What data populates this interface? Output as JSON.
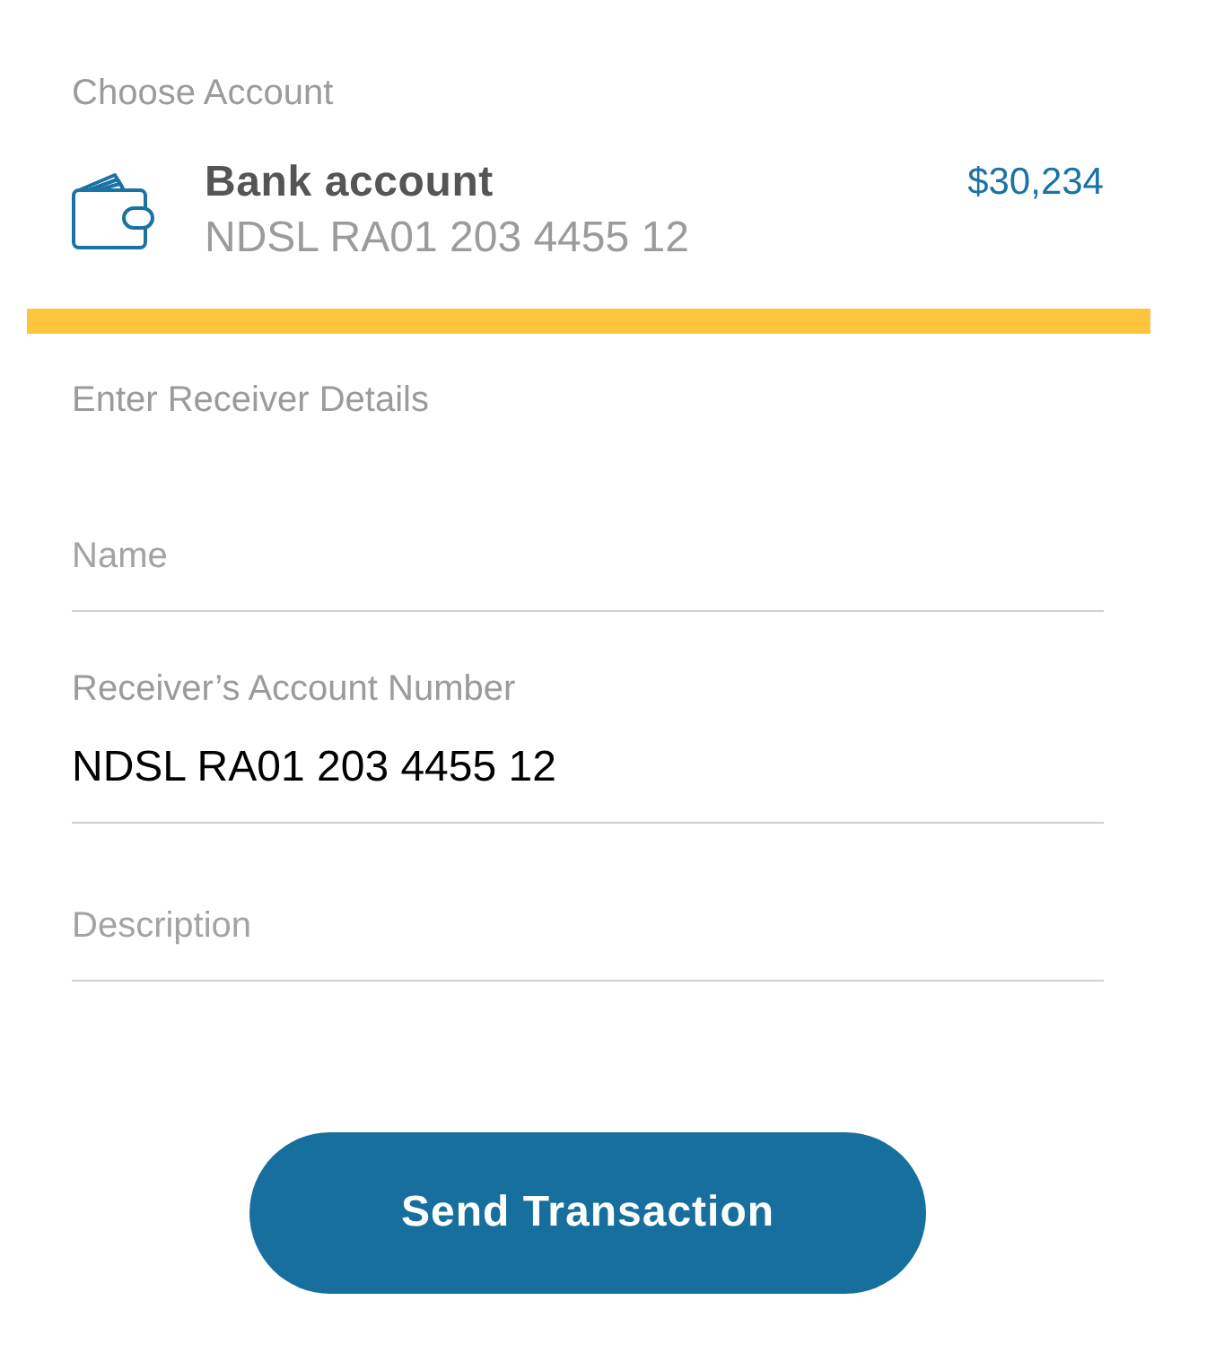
{
  "account_section": {
    "heading": "Choose Account",
    "account": {
      "name": "Bank account",
      "number": "NDSL RA01 203 4455 12",
      "balance": "$30,234"
    }
  },
  "receiver_section": {
    "heading": "Enter Receiver Details",
    "fields": [
      {
        "kind": "empty",
        "placeholder": "Name"
      },
      {
        "kind": "filled",
        "label": "Receiver’s Account Number",
        "value": "NDSL RA01 203 4455 12"
      },
      {
        "kind": "empty",
        "placeholder": "Description"
      }
    ]
  },
  "submit_button": {
    "label": "Send Transaction"
  }
}
